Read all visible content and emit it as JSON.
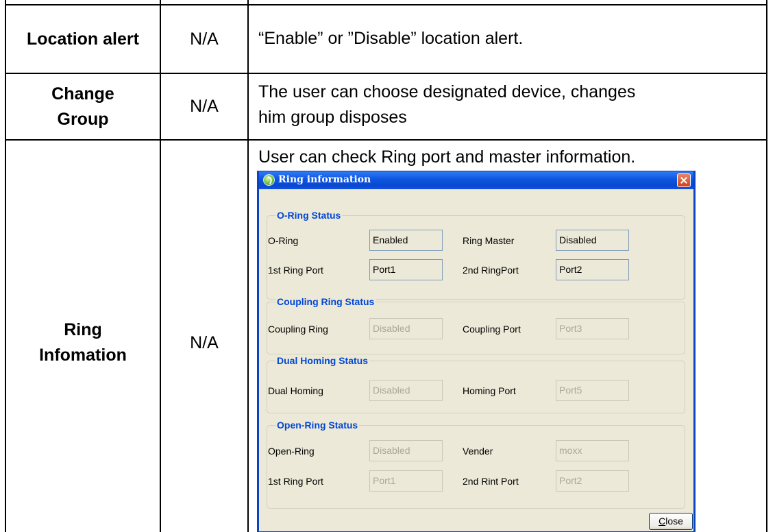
{
  "table": {
    "rows": [
      {
        "name": "Location alert",
        "value": "N/A",
        "description": "“Enable” or ”Disable” location alert."
      },
      {
        "name_line1": "Change",
        "name_line2": "Group",
        "value": "N/A",
        "description_line1": "The user can choose designated device, changes",
        "description_line2": "him group disposes"
      },
      {
        "name_line1": "Ring",
        "name_line2": "Infomation",
        "value": "N/A",
        "description": "User can check Ring port and master information."
      }
    ]
  },
  "dialog": {
    "title": "Ring information",
    "groups": {
      "oring": {
        "title": "O-Ring Status",
        "oring_label": "O-Ring",
        "oring_value": "Enabled",
        "master_label": "Ring Master",
        "master_value": "Disabled",
        "port1_label": "1st Ring Port",
        "port1_value": "Port1",
        "port2_label": "2nd RingPort",
        "port2_value": "Port2"
      },
      "coupling": {
        "title": "Coupling Ring Status",
        "ring_label": "Coupling Ring",
        "ring_value": "Disabled",
        "port_label": "Coupling Port",
        "port_value": "Port3"
      },
      "dual": {
        "title": "Dual Homing Status",
        "homing_label": "Dual Homing",
        "homing_value": "Disabled",
        "port_label": "Homing Port",
        "port_value": "Port5"
      },
      "openring": {
        "title": "Open-Ring Status",
        "open_label": "Open-Ring",
        "open_value": "Disabled",
        "vender_label": "Vender",
        "vender_value": "moxx",
        "port1_label": "1st Ring Port",
        "port1_value": "Port1",
        "port2_label": "2nd Rint Port",
        "port2_value": "Port2"
      }
    },
    "close_mnemonic": "C",
    "close_rest": "lose"
  }
}
